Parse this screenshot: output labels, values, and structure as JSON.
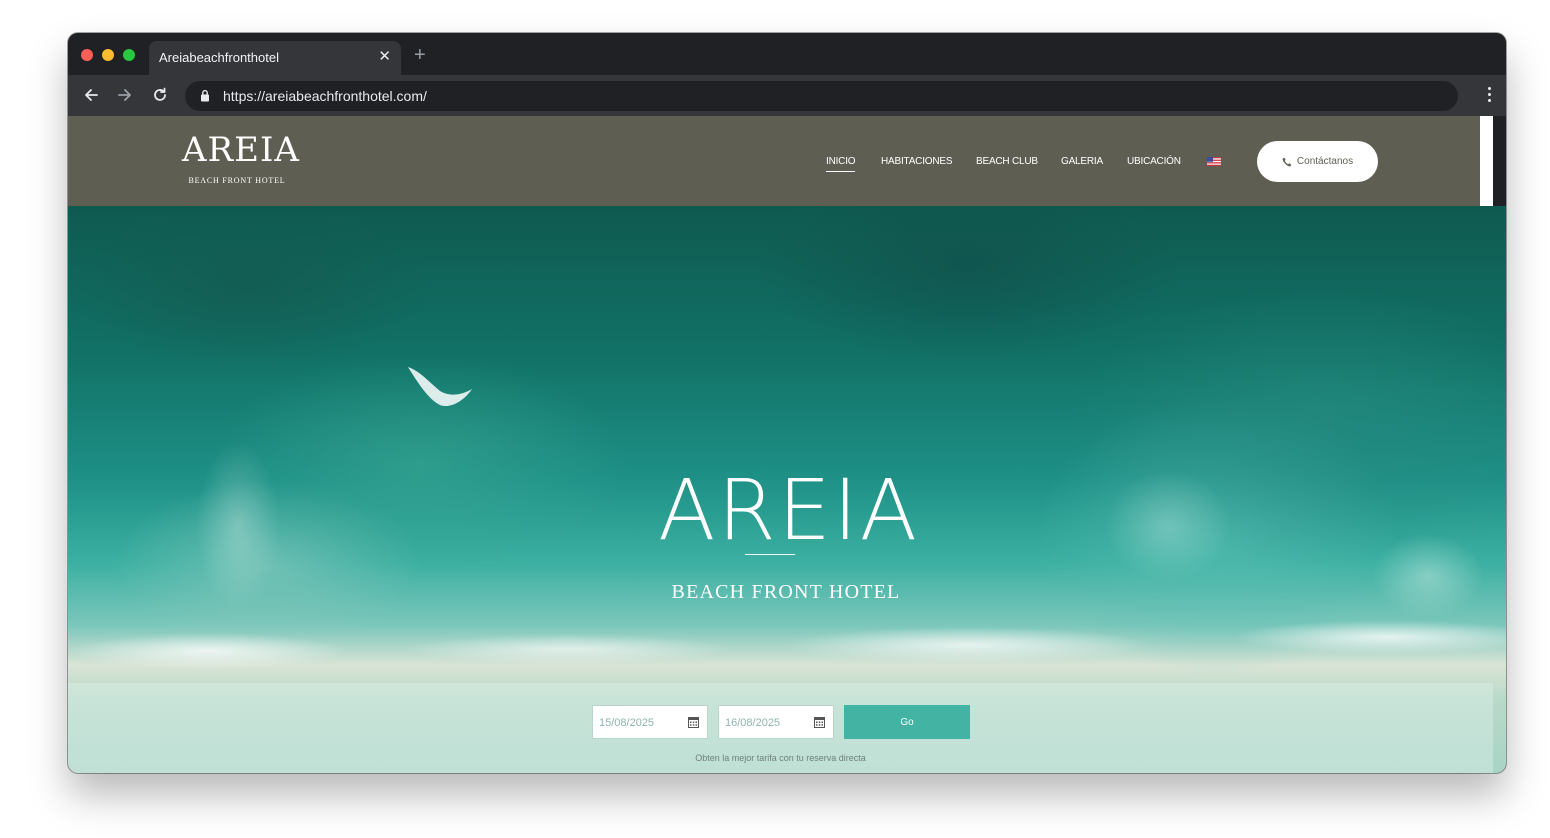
{
  "browser": {
    "tab_title": "Areiabeachfronthotel",
    "tab_close": "✕",
    "new_tab": "+",
    "url": "https://areiabeachfronthotel.com/"
  },
  "site": {
    "logo": {
      "word": "AREIA",
      "sub": "BEACH FRONT HOTEL"
    },
    "nav": [
      "INICIO",
      "HABITACIONES",
      "BEACH CLUB",
      "GALERIA",
      "UBICACIÓN"
    ],
    "active_nav": "INICIO",
    "contact_button": "Contáctanos",
    "colors": {
      "header": "#5f5e52",
      "accent": "#43b3a4"
    }
  },
  "hero": {
    "title": "AREIA",
    "subtitle": "BEACH FRONT HOTEL"
  },
  "booking": {
    "checkin": "15/08/2025",
    "checkout": "16/08/2025",
    "go_label": "Go",
    "promo": "Obten la mejor tarifa con tu reserva directa"
  }
}
